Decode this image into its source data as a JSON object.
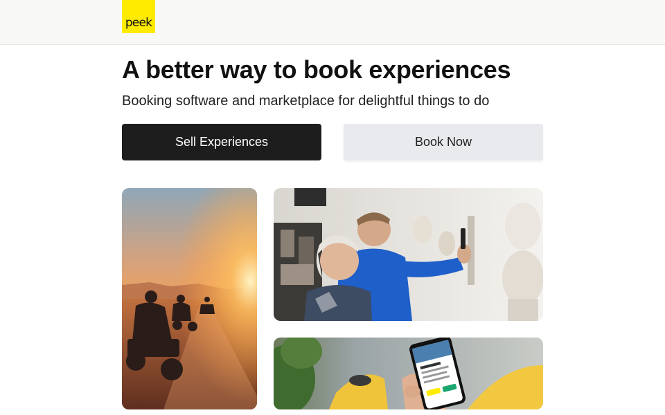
{
  "header": {
    "logo_text": "peek"
  },
  "hero": {
    "title": "A better way to book experiences",
    "subtitle": "Booking software and marketplace for delightful things to do"
  },
  "actions": {
    "sell_label": "Sell Experiences",
    "book_label": "Book Now"
  },
  "gallery": {
    "images": [
      {
        "subject": "atv-desert-sunset-photo"
      },
      {
        "subject": "museum-visitors-photo"
      },
      {
        "subject": "phone-booking-app-photo"
      }
    ]
  },
  "colors": {
    "brand_yellow": "#ffeb00",
    "primary_button": "#1d1d1d",
    "secondary_button": "#e9eaed",
    "header_bg": "#f8f8f6"
  }
}
